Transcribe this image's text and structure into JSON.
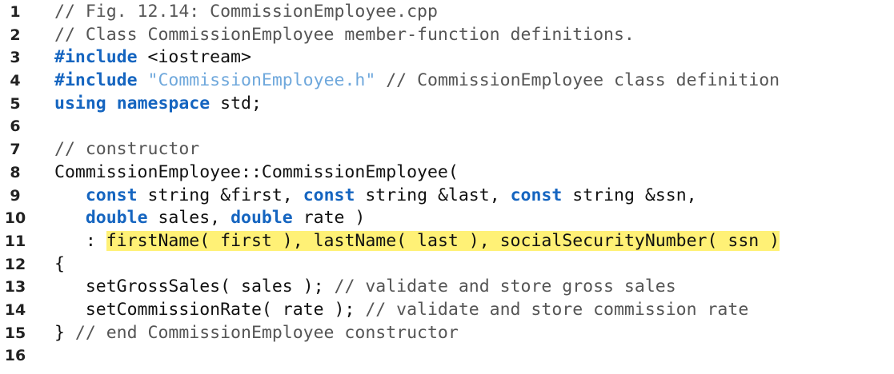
{
  "listing": {
    "lines": [
      {
        "num": "1",
        "tokens": [
          {
            "text": "// Fig. 12.14: CommissionEmployee.cpp",
            "type": "comment"
          }
        ]
      },
      {
        "num": "2",
        "tokens": [
          {
            "text": "// Class CommissionEmployee member-function definitions.",
            "type": "comment"
          }
        ]
      },
      {
        "num": "3",
        "tokens": [
          {
            "text": "#include",
            "type": "keyword"
          },
          {
            "text": " <iostream>",
            "type": "plain"
          }
        ]
      },
      {
        "num": "4",
        "tokens": [
          {
            "text": "#include",
            "type": "keyword"
          },
          {
            "text": " ",
            "type": "plain"
          },
          {
            "text": "\"CommissionEmployee.h\"",
            "type": "string"
          },
          {
            "text": " // CommissionEmployee class definition",
            "type": "comment"
          }
        ]
      },
      {
        "num": "5",
        "tokens": [
          {
            "text": "using",
            "type": "keyword"
          },
          {
            "text": " ",
            "type": "plain"
          },
          {
            "text": "namespace",
            "type": "keyword"
          },
          {
            "text": " std;",
            "type": "plain"
          }
        ]
      },
      {
        "num": "6",
        "tokens": []
      },
      {
        "num": "7",
        "tokens": [
          {
            "text": "// constructor",
            "type": "comment"
          }
        ]
      },
      {
        "num": "8",
        "tokens": [
          {
            "text": "CommissionEmployee::CommissionEmployee(",
            "type": "plain"
          }
        ]
      },
      {
        "num": "9",
        "tokens": [
          {
            "text": "   ",
            "type": "plain"
          },
          {
            "text": "const",
            "type": "keyword"
          },
          {
            "text": " string &first, ",
            "type": "plain"
          },
          {
            "text": "const",
            "type": "keyword"
          },
          {
            "text": " string &last, ",
            "type": "plain"
          },
          {
            "text": "const",
            "type": "keyword"
          },
          {
            "text": " string &ssn,",
            "type": "plain"
          }
        ]
      },
      {
        "num": "10",
        "tokens": [
          {
            "text": "   ",
            "type": "plain"
          },
          {
            "text": "double",
            "type": "keyword"
          },
          {
            "text": " sales, ",
            "type": "plain"
          },
          {
            "text": "double",
            "type": "keyword"
          },
          {
            "text": " rate )",
            "type": "plain"
          }
        ]
      },
      {
        "num": "11",
        "tokens": [
          {
            "text": "   : ",
            "type": "plain"
          },
          {
            "text": "firstName( first ), lastName( last ), socialSecurityNumber( ssn )",
            "type": "hl"
          }
        ]
      },
      {
        "num": "12",
        "tokens": [
          {
            "text": "{",
            "type": "plain"
          }
        ]
      },
      {
        "num": "13",
        "tokens": [
          {
            "text": "   setGrossSales( sales ); ",
            "type": "plain"
          },
          {
            "text": "// validate and store gross sales",
            "type": "comment"
          }
        ]
      },
      {
        "num": "14",
        "tokens": [
          {
            "text": "   setCommissionRate( rate ); ",
            "type": "plain"
          },
          {
            "text": "// validate and store commission rate",
            "type": "comment"
          }
        ]
      },
      {
        "num": "15",
        "tokens": [
          {
            "text": "} ",
            "type": "plain"
          },
          {
            "text": "// end CommissionEmployee constructor",
            "type": "comment"
          }
        ]
      },
      {
        "num": "16",
        "tokens": []
      }
    ]
  }
}
